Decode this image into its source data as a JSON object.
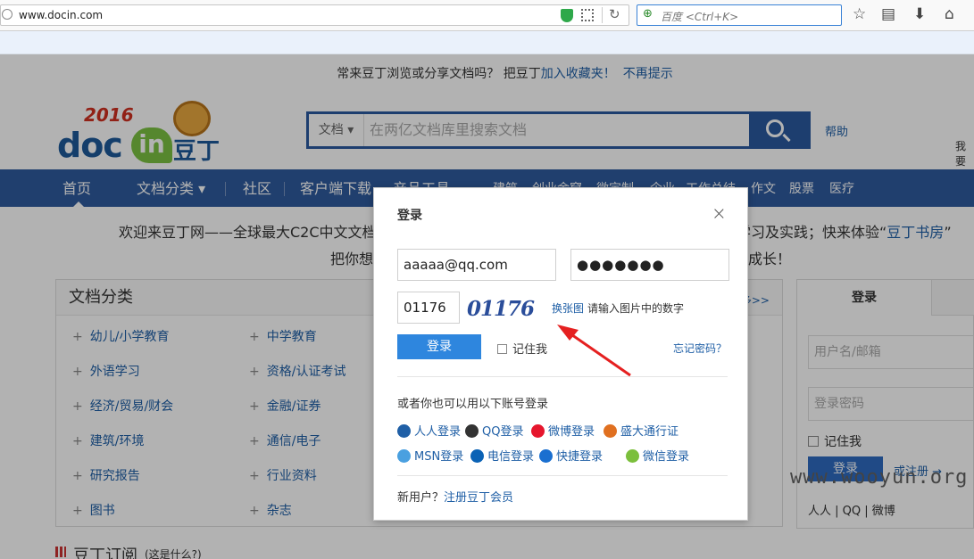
{
  "browser": {
    "url": "www.docin.com",
    "search_placeholder": "百度 <Ctrl+K>"
  },
  "tip_bar": {
    "text": "常来豆丁浏览或分享文档吗？ 把豆丁",
    "link1": "加入收藏夹！",
    "link2": "不再提示"
  },
  "logo": {
    "year": "2016",
    "doc": "doc",
    "in": "in",
    "cn": "豆丁"
  },
  "search": {
    "category": "文档",
    "placeholder": "在两亿文档库里搜索文档"
  },
  "header": {
    "help": "帮助",
    "my": "我要"
  },
  "nav": {
    "items": [
      "首页",
      "文档分类",
      "社区",
      "客户端下载",
      "产品工具",
      "建筑",
      "创业金窟",
      "微定制",
      "企业",
      "工作总结",
      "作文",
      "股票",
      "医疗"
    ]
  },
  "welcome": {
    "line1a": "欢迎来豆丁网——全球最大C2C中文文档",
    "line1b": "学习及实践；快来体验“",
    "line1c": "豆丁书房",
    "line1d": "”",
    "line2a": "把你想",
    "line2b": "成长！"
  },
  "categories": {
    "title": "文档分类",
    "more": "多>>",
    "items": [
      "幼儿/小学教育",
      "中学教育",
      "外语学习",
      "资格/认证考试",
      "经济/贸易/财会",
      "金融/证券",
      "建筑/环境",
      "通信/电子",
      "研究报告",
      "行业资料",
      "图书",
      "杂志"
    ]
  },
  "subscribe": {
    "title": "豆丁订阅",
    "sub": "(这是什么?)"
  },
  "side_login": {
    "tab": "登录",
    "user_placeholder": "用户名/邮箱",
    "pass_placeholder": "登录密码",
    "remember": "记住我",
    "button": "登录",
    "register": "或注册 →",
    "social": "人人  |  QQ  |  微博"
  },
  "watermark": "www.wooyun.org",
  "dialog": {
    "title": "登录",
    "close": "×",
    "email": "aaaaa@qq.com",
    "password": "●●●●●●●",
    "captcha_input": "01176",
    "captcha_image_text": "01176",
    "change": "换张图",
    "hint": "请输入图片中的数字",
    "login": "登录",
    "remember": "记住我",
    "forgot": "忘记密码？",
    "or": "或者你也可以用以下账号登录",
    "social1": [
      "人人登录",
      "QQ登录",
      "微博登录",
      "盛大通行证"
    ],
    "social2": [
      "MSN登录",
      "电信登录",
      "快捷登录",
      "微信登录"
    ],
    "new_user": "新用户？",
    "register": "注册豆丁会员"
  },
  "colors": {
    "brand_blue": "#2e5b9e",
    "link": "#1f5fa6",
    "button": "#2e86de",
    "annotation_arrow": "#e52020"
  }
}
